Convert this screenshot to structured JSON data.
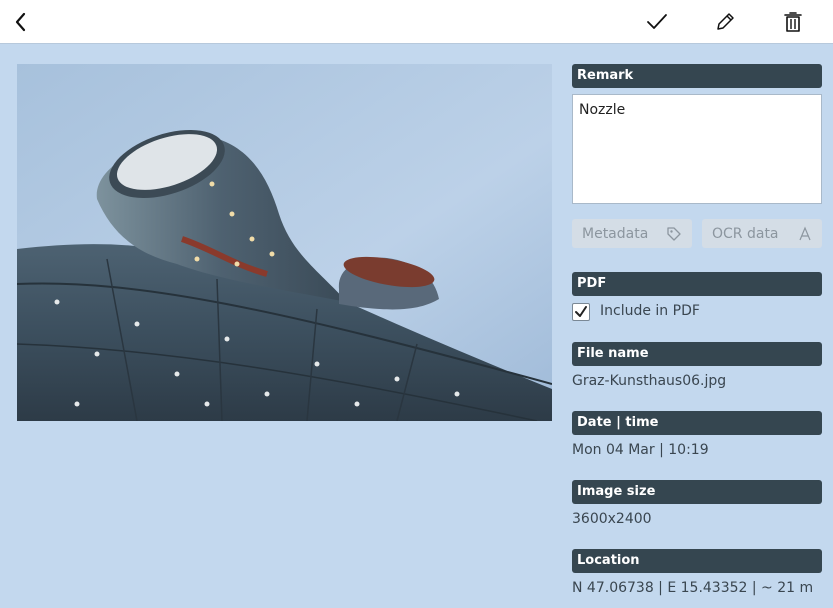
{
  "toolbar": {
    "back_icon": "chevron-left-icon",
    "confirm_icon": "checkmark-icon",
    "edit_icon": "pencil-icon",
    "delete_icon": "trash-icon"
  },
  "photo": {
    "subject": "Graz Kunsthaus"
  },
  "remark": {
    "header": "Remark",
    "text": "Nozzle"
  },
  "buttons": {
    "metadata": "Metadata",
    "ocr": "OCR data"
  },
  "pdf": {
    "header": "PDF",
    "include_label": "Include in PDF",
    "include_checked": true
  },
  "file_name": {
    "header": "File name",
    "value": "Graz-Kunsthaus06.jpg"
  },
  "date_time": {
    "header": "Date | time",
    "value": "Mon 04 Mar | 10:19"
  },
  "image_size": {
    "header": "Image size",
    "value": "3600x2400"
  },
  "location": {
    "header": "Location",
    "value": "N 47.06738 | E 15.43352 | ~ 21 m"
  },
  "colors": {
    "background": "#c3d8ee",
    "header": "#354650",
    "button": "#d4dde6"
  }
}
